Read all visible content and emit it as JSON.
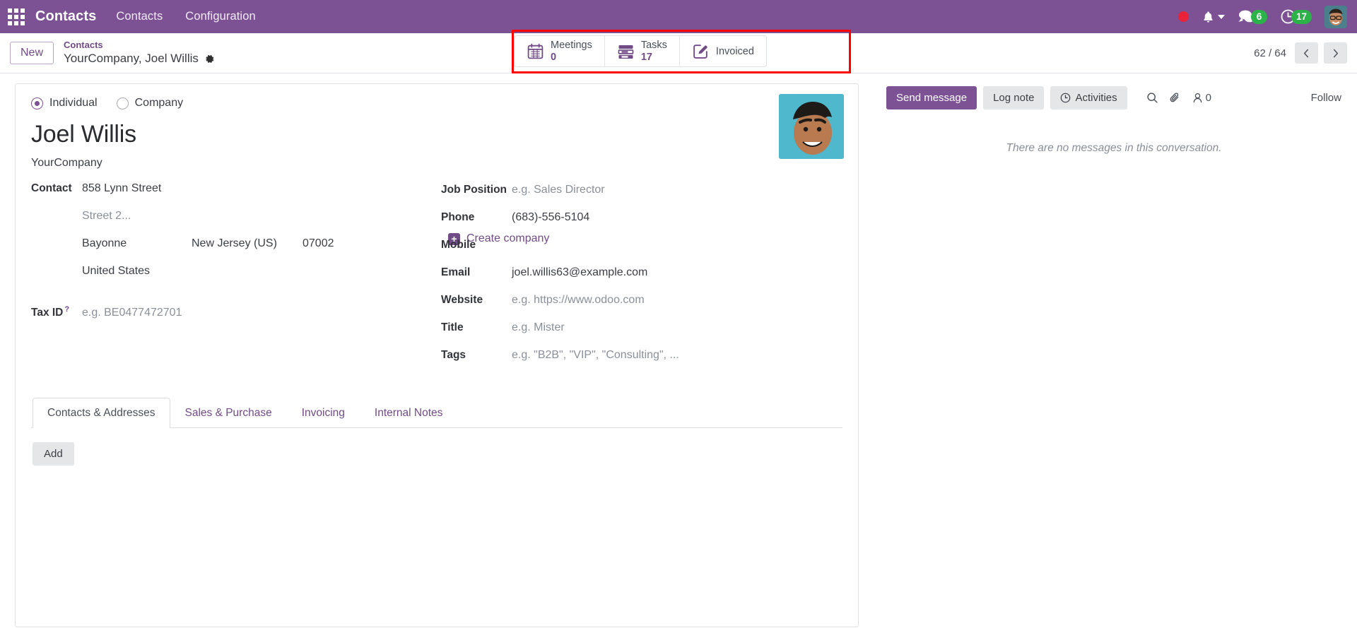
{
  "navbar": {
    "apps_icon": "apps-grid-icon",
    "brand": "Contacts",
    "menus": [
      {
        "label": "Contacts"
      },
      {
        "label": "Configuration"
      }
    ],
    "recording_icon": "record-dot-icon",
    "bell_icon": "bell-icon",
    "messages_icon": "messages-icon",
    "messages_count": "6",
    "activities_icon": "clock-icon",
    "activities_count": "17",
    "avatar": "user-avatar",
    "accent_color": "#7C5295",
    "badge_color": "#2bb34a",
    "record_color": "#e8233a"
  },
  "control_panel": {
    "new_button": "New",
    "breadcrumb_parent": "Contacts",
    "breadcrumb_current": "YourCompany, Joel Willis",
    "gear_icon": "gear-icon",
    "pager": "62 / 64",
    "prev_icon": "chevron-left-icon",
    "next_icon": "chevron-right-icon",
    "highlight_color": "#ff0000"
  },
  "stat_buttons": [
    {
      "icon": "calendar-icon",
      "label": "Meetings",
      "value": "0"
    },
    {
      "icon": "tasks-icon",
      "label": "Tasks",
      "value": "17"
    },
    {
      "icon": "pencil-square-icon",
      "label": "Invoiced",
      "value": ""
    }
  ],
  "form": {
    "type_options": [
      {
        "label": "Individual",
        "selected": true
      },
      {
        "label": "Company",
        "selected": false
      }
    ],
    "name": "Joel Willis",
    "parent_company": "YourCompany",
    "create_company_label": "Create company",
    "create_company_icon": "plus-square-icon",
    "avatar": "contact-avatar",
    "left_fields": {
      "contact_label": "Contact",
      "street": "858 Lynn Street",
      "street2_placeholder": "Street 2...",
      "city": "Bayonne",
      "state": "New Jersey (US)",
      "zip": "07002",
      "country": "United States",
      "tax_id_label": "Tax ID",
      "tax_id_help": "?",
      "tax_id_placeholder": "e.g. BE0477472701"
    },
    "right_fields": [
      {
        "label": "Job Position",
        "value": "e.g. Sales Director",
        "is_placeholder": true
      },
      {
        "label": "Phone",
        "value": "(683)-556-5104",
        "is_placeholder": false
      },
      {
        "label": "Mobile",
        "value": "",
        "is_placeholder": false
      },
      {
        "label": "Email",
        "value": "joel.willis63@example.com",
        "is_placeholder": false
      },
      {
        "label": "Website",
        "value": "e.g. https://www.odoo.com",
        "is_placeholder": true
      },
      {
        "label": "Title",
        "value": "e.g. Mister",
        "is_placeholder": true
      },
      {
        "label": "Tags",
        "value": "e.g. \"B2B\", \"VIP\", \"Consulting\", ...",
        "is_placeholder": true
      }
    ],
    "tabs": [
      {
        "label": "Contacts & Addresses",
        "active": true
      },
      {
        "label": "Sales & Purchase",
        "active": false
      },
      {
        "label": "Invoicing",
        "active": false
      },
      {
        "label": "Internal Notes",
        "active": false
      }
    ],
    "add_button": "Add"
  },
  "chatter": {
    "send_message": "Send message",
    "log_note": "Log note",
    "activities": "Activities",
    "activities_icon": "clock-icon",
    "search_icon": "search-icon",
    "attachment_icon": "paperclip-icon",
    "followers_icon": "user-icon",
    "followers_count": "0",
    "follow_label": "Follow",
    "empty_message": "There are no messages in this conversation."
  }
}
